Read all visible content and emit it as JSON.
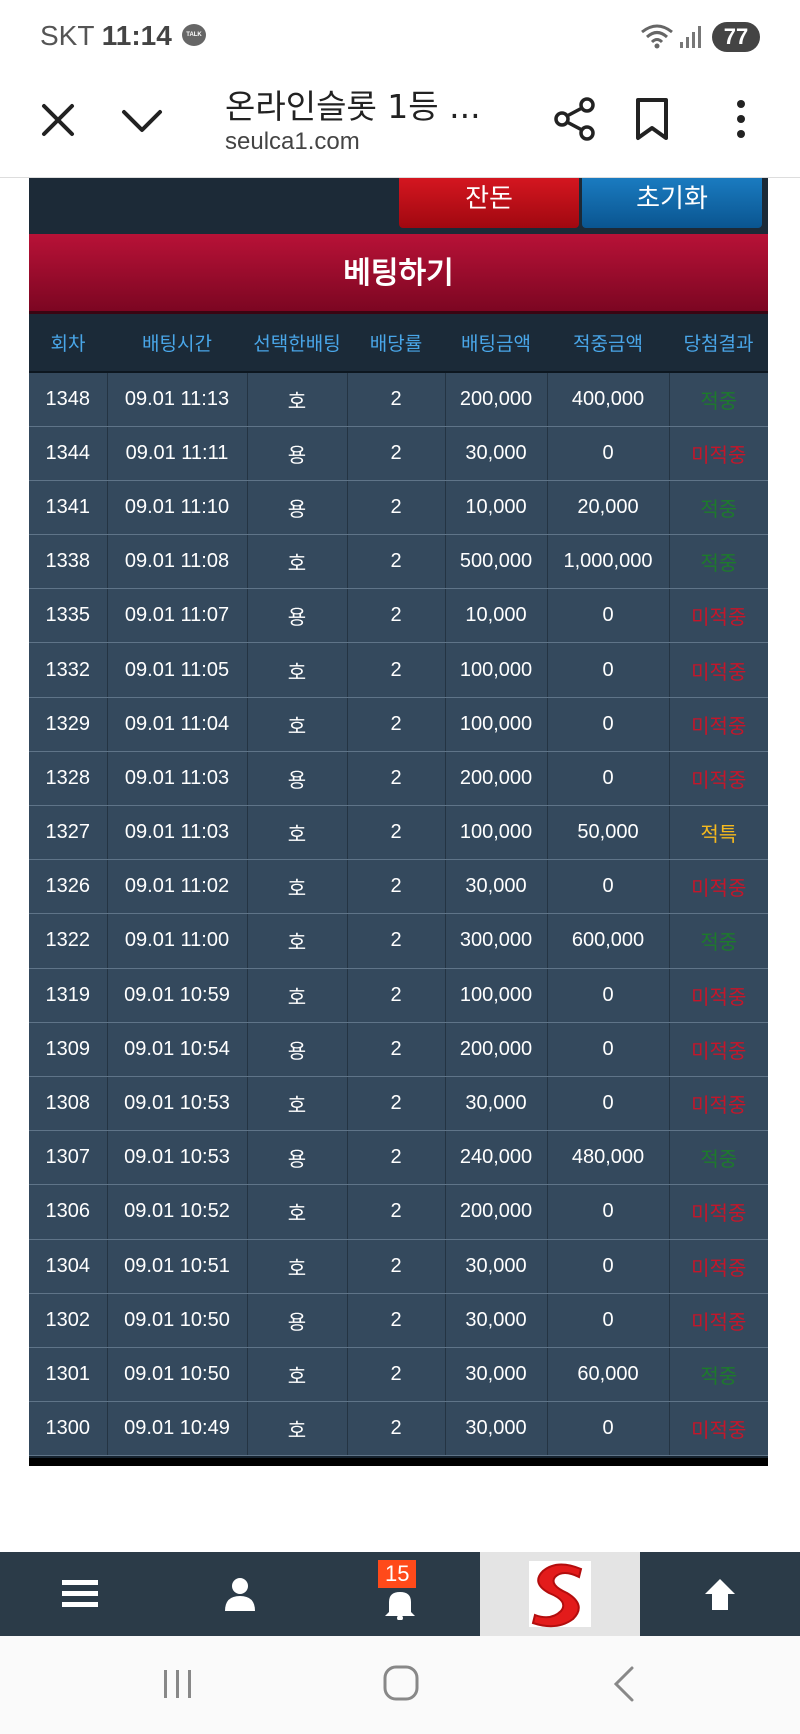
{
  "status": {
    "carrier": "SKT",
    "time": "11:14",
    "talk": "TALK",
    "battery": "77"
  },
  "browser": {
    "title": "온라인슬롯 1등 ...",
    "url": "seulca1.com"
  },
  "page": {
    "buttons": {
      "jandon": "잔돈",
      "reset": "초기화"
    },
    "section_title": "베팅하기",
    "table": {
      "headers": [
        "회차",
        "배팅시간",
        "선택한배팅",
        "배당률",
        "배팅금액",
        "적중금액",
        "당첨결과"
      ],
      "rows": [
        {
          "round": "1348",
          "time": "09.01 11:13",
          "pick": "호",
          "odds": "2",
          "bet": "200,000",
          "win": "400,000",
          "result": "적중",
          "status": "hit"
        },
        {
          "round": "1344",
          "time": "09.01 11:11",
          "pick": "용",
          "odds": "2",
          "bet": "30,000",
          "win": "0",
          "result": "미적중",
          "status": "miss"
        },
        {
          "round": "1341",
          "time": "09.01 11:10",
          "pick": "용",
          "odds": "2",
          "bet": "10,000",
          "win": "20,000",
          "result": "적중",
          "status": "hit"
        },
        {
          "round": "1338",
          "time": "09.01 11:08",
          "pick": "호",
          "odds": "2",
          "bet": "500,000",
          "win": "1,000,000",
          "result": "적중",
          "status": "hit"
        },
        {
          "round": "1335",
          "time": "09.01 11:07",
          "pick": "용",
          "odds": "2",
          "bet": "10,000",
          "win": "0",
          "result": "미적중",
          "status": "miss"
        },
        {
          "round": "1332",
          "time": "09.01 11:05",
          "pick": "호",
          "odds": "2",
          "bet": "100,000",
          "win": "0",
          "result": "미적중",
          "status": "miss"
        },
        {
          "round": "1329",
          "time": "09.01 11:04",
          "pick": "호",
          "odds": "2",
          "bet": "100,000",
          "win": "0",
          "result": "미적중",
          "status": "miss"
        },
        {
          "round": "1328",
          "time": "09.01 11:03",
          "pick": "용",
          "odds": "2",
          "bet": "200,000",
          "win": "0",
          "result": "미적중",
          "status": "miss"
        },
        {
          "round": "1327",
          "time": "09.01 11:03",
          "pick": "호",
          "odds": "2",
          "bet": "100,000",
          "win": "50,000",
          "result": "적특",
          "status": "special"
        },
        {
          "round": "1326",
          "time": "09.01 11:02",
          "pick": "호",
          "odds": "2",
          "bet": "30,000",
          "win": "0",
          "result": "미적중",
          "status": "miss"
        },
        {
          "round": "1322",
          "time": "09.01 11:00",
          "pick": "호",
          "odds": "2",
          "bet": "300,000",
          "win": "600,000",
          "result": "적중",
          "status": "hit"
        },
        {
          "round": "1319",
          "time": "09.01 10:59",
          "pick": "호",
          "odds": "2",
          "bet": "100,000",
          "win": "0",
          "result": "미적중",
          "status": "miss"
        },
        {
          "round": "1309",
          "time": "09.01 10:54",
          "pick": "용",
          "odds": "2",
          "bet": "200,000",
          "win": "0",
          "result": "미적중",
          "status": "miss"
        },
        {
          "round": "1308",
          "time": "09.01 10:53",
          "pick": "호",
          "odds": "2",
          "bet": "30,000",
          "win": "0",
          "result": "미적중",
          "status": "miss"
        },
        {
          "round": "1307",
          "time": "09.01 10:53",
          "pick": "용",
          "odds": "2",
          "bet": "240,000",
          "win": "480,000",
          "result": "적중",
          "status": "hit"
        },
        {
          "round": "1306",
          "time": "09.01 10:52",
          "pick": "호",
          "odds": "2",
          "bet": "200,000",
          "win": "0",
          "result": "미적중",
          "status": "miss"
        },
        {
          "round": "1304",
          "time": "09.01 10:51",
          "pick": "호",
          "odds": "2",
          "bet": "30,000",
          "win": "0",
          "result": "미적중",
          "status": "miss"
        },
        {
          "round": "1302",
          "time": "09.01 10:50",
          "pick": "용",
          "odds": "2",
          "bet": "30,000",
          "win": "0",
          "result": "미적중",
          "status": "miss"
        },
        {
          "round": "1301",
          "time": "09.01 10:50",
          "pick": "호",
          "odds": "2",
          "bet": "30,000",
          "win": "60,000",
          "result": "적중",
          "status": "hit"
        },
        {
          "round": "1300",
          "time": "09.01 10:49",
          "pick": "호",
          "odds": "2",
          "bet": "30,000",
          "win": "0",
          "result": "미적중",
          "status": "miss"
        }
      ]
    }
  },
  "bottom_nav": {
    "items": [
      "menu-icon",
      "user-icon",
      "bell-icon",
      "site-logo",
      "arrow-up-icon"
    ],
    "notification_count": "15"
  },
  "colors": {
    "hit": "#1d7a2c",
    "miss": "#c4162a",
    "special": "#f5b91e",
    "header_red": "#b81237",
    "table_row": "#34495d"
  }
}
